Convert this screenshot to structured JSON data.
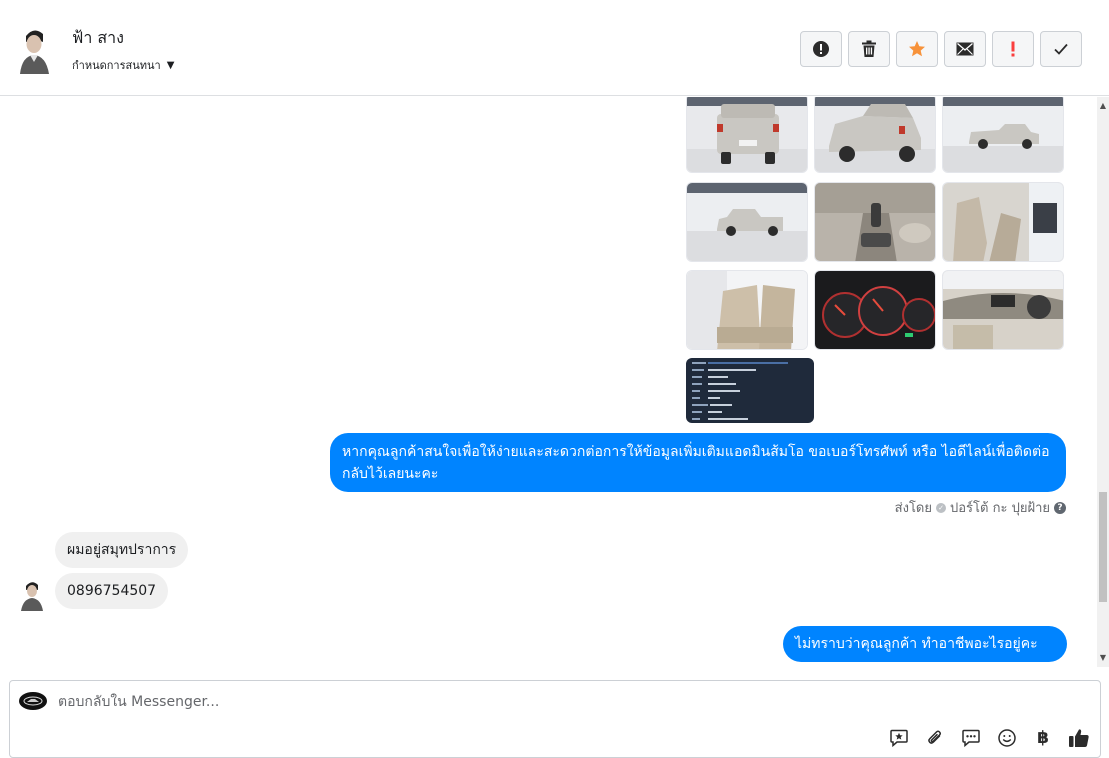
{
  "header": {
    "contact_name": "ฟ้า สาง",
    "conversation_menu_label": "กำหนดการสนทนา",
    "actions": [
      {
        "name": "spam-button",
        "icon": "exclamation-circle-icon"
      },
      {
        "name": "delete-button",
        "icon": "trash-icon"
      },
      {
        "name": "star-button",
        "icon": "star-icon",
        "color": "#f7923a"
      },
      {
        "name": "mark-unread-button",
        "icon": "envelope-icon"
      },
      {
        "name": "follow-up-button",
        "icon": "exclamation-icon",
        "color": "#fa3e3e"
      },
      {
        "name": "mark-done-button",
        "icon": "checkmark-icon"
      }
    ]
  },
  "messages": {
    "outgoing_1": "หากคุณลูกค้าสนใจเพื่อให้ง่ายและสะดวกต่อการให้ข้อมูลเพิ่มเติมแอดมินส้มโอ ขอเบอร์โทรศัพท์ หรือ ไอดีไลน์เพื่อติดต่อกลับไว้เลยนะคะ",
    "sent_by_label": "ส่งโดย",
    "sent_by_name": "ปอร์โต้ กะ ปุยฝ้าย",
    "incoming_1": "ผมอยู่สมุทปราการ",
    "incoming_2": "0896754507",
    "outgoing_2": "ไม่ทราบว่าคุณลูกค้า ทำอาชีพอะไรอยู่คะ"
  },
  "photos": [
    {
      "name": "photo-truck-rear",
      "kind": "truck-rear"
    },
    {
      "name": "photo-truck-rear-angle",
      "kind": "truck-angle"
    },
    {
      "name": "photo-truck-side-right",
      "kind": "truck-side"
    },
    {
      "name": "photo-truck-side-left",
      "kind": "truck-side"
    },
    {
      "name": "photo-gear-console",
      "kind": "interior-console"
    },
    {
      "name": "photo-front-seats",
      "kind": "interior-seats"
    },
    {
      "name": "photo-rear-seats",
      "kind": "interior-rear"
    },
    {
      "name": "photo-gauge-cluster",
      "kind": "gauges"
    },
    {
      "name": "photo-dashboard",
      "kind": "dashboard"
    },
    {
      "name": "photo-spec-sheet",
      "kind": "spec-sheet"
    }
  ],
  "composer": {
    "placeholder": "ตอบกลับใน Messenger...",
    "currency_symbol": "฿"
  },
  "colors": {
    "accent": "#0084ff",
    "star": "#f7923a",
    "follow_up": "#fa3e3e"
  }
}
